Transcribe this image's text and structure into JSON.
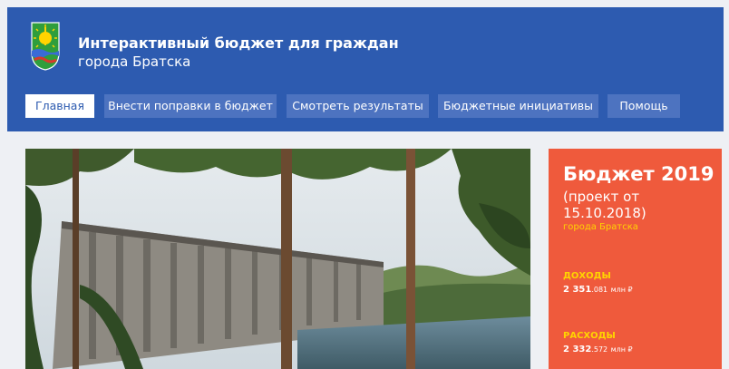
{
  "header": {
    "title": "Интерактивный бюджет для граждан",
    "subtitle": "города Братска"
  },
  "nav": {
    "items": [
      {
        "label": "Главная"
      },
      {
        "label": "Внести поправки в бюджет"
      },
      {
        "label": "Смотреть результаты"
      },
      {
        "label": "Бюджетные инициативы"
      },
      {
        "label": "Помощь"
      }
    ]
  },
  "budget": {
    "title": "Бюджет 2019",
    "subtitle": "(проект от 15.10.2018)",
    "city": "города Братска",
    "income": {
      "label": "ДОХОДЫ",
      "big": "2 351",
      "small": ".081",
      "unit": "млн ₽"
    },
    "expense": {
      "label": "РАСХОДЫ",
      "big": "2 332",
      "small": ".572",
      "unit": "млн ₽"
    }
  },
  "colors": {
    "header_bg": "#2d5bb0",
    "nav_bg": "#4d73c0",
    "card_bg": "#ef5a3c",
    "accent_yellow": "#ffd400"
  }
}
